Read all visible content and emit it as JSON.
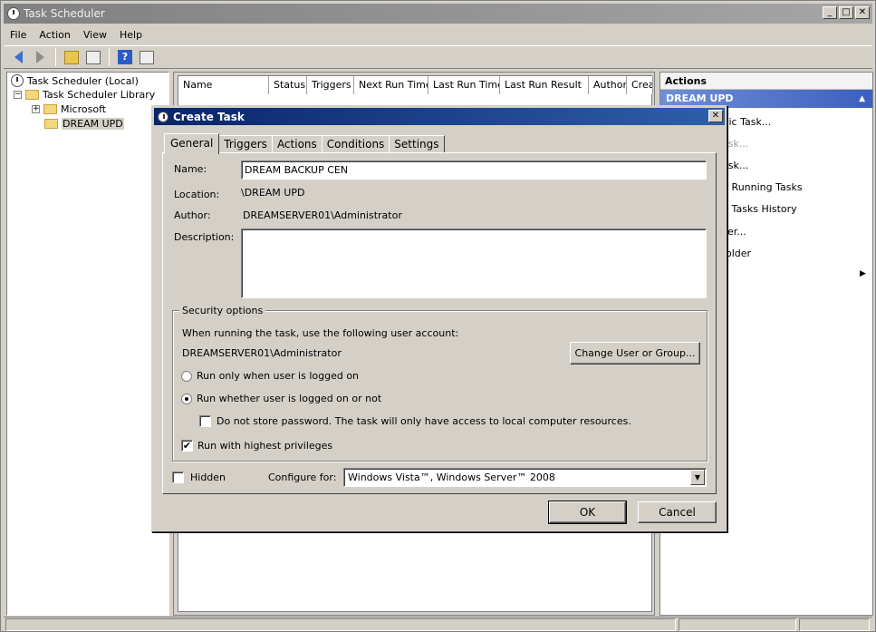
{
  "window": {
    "title": "Task Scheduler"
  },
  "menu": [
    "File",
    "Action",
    "View",
    "Help"
  ],
  "tree": {
    "root": "Task Scheduler (Local)",
    "library": "Task Scheduler Library",
    "microsoft": "Microsoft",
    "dream": "DREAM UPD"
  },
  "columns": [
    "Name",
    "Status",
    "Triggers",
    "Next Run Time",
    "Last Run Time",
    "Last Run Result",
    "Author",
    "Creat"
  ],
  "actions": {
    "header": "Actions",
    "section": "DREAM UPD",
    "items": [
      "asic Task...",
      "ask...",
      "ask...",
      "l Running Tasks",
      "l Tasks History",
      "er...",
      "older"
    ]
  },
  "dialog": {
    "title": "Create Task",
    "tabs": [
      "General",
      "Triggers",
      "Actions",
      "Conditions",
      "Settings"
    ],
    "name_label": "Name:",
    "name_value": "DREAM BACKUP CEN",
    "location_label": "Location:",
    "location_value": "\\DREAM UPD",
    "author_label": "Author:",
    "author_value": "DREAMSERVER01\\Administrator",
    "description_label": "Description:",
    "description_value": "",
    "security": {
      "legend": "Security options",
      "account_prompt": "When running the task, use the following user account:",
      "account_value": "DREAMSERVER01\\Administrator",
      "change_button": "Change User or Group...",
      "radio_logged_on": "Run only when user is logged on",
      "radio_whether": "Run whether user is logged on or not",
      "no_store_password": "Do not store password.  The task will only have access to local computer resources.",
      "highest_privileges": "Run with highest privileges"
    },
    "hidden_label": "Hidden",
    "configure_label": "Configure for:",
    "configure_value": "Windows Vista™, Windows Server™ 2008",
    "ok": "OK",
    "cancel": "Cancel"
  }
}
